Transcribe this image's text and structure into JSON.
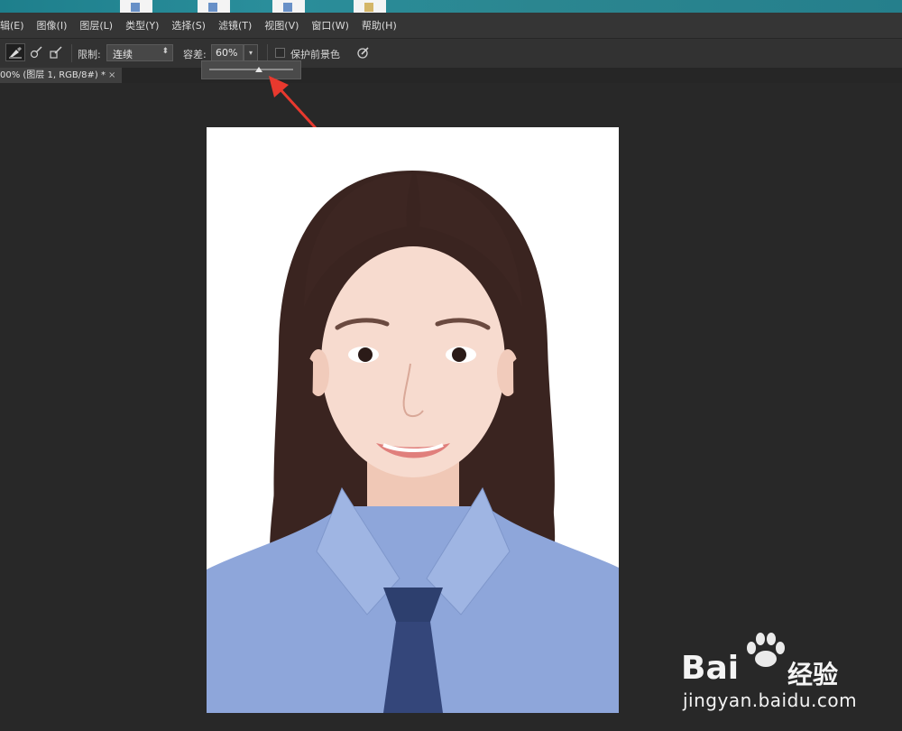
{
  "menubar": {
    "items": [
      "辑(E)",
      "图像(I)",
      "图层(L)",
      "类型(Y)",
      "选择(S)",
      "滤镜(T)",
      "视图(V)",
      "窗口(W)",
      "帮助(H)"
    ]
  },
  "options": {
    "limit_label": "限制:",
    "limit_value": "连续",
    "tolerance_label": "容差:",
    "tolerance_value": "60%",
    "protect_label": "保护前景色"
  },
  "document": {
    "tab_title": "00% (图层 1, RGB/8#) *",
    "tab_close": "×"
  },
  "watermark": {
    "brand_latin": "Bai",
    "brand_cn": "经验",
    "url": "jingyan.baidu.com"
  },
  "colors": {
    "background": "#282828",
    "shirt": "#8ea6da",
    "tie": "#2d3f6e",
    "arrow": "#e8392e"
  },
  "icons": {
    "tool_active": "background-eraser-icon",
    "tool_2": "sampling-once-icon",
    "tool_3": "sampling-swatch-icon",
    "pressure": "tablet-pressure-icon"
  }
}
